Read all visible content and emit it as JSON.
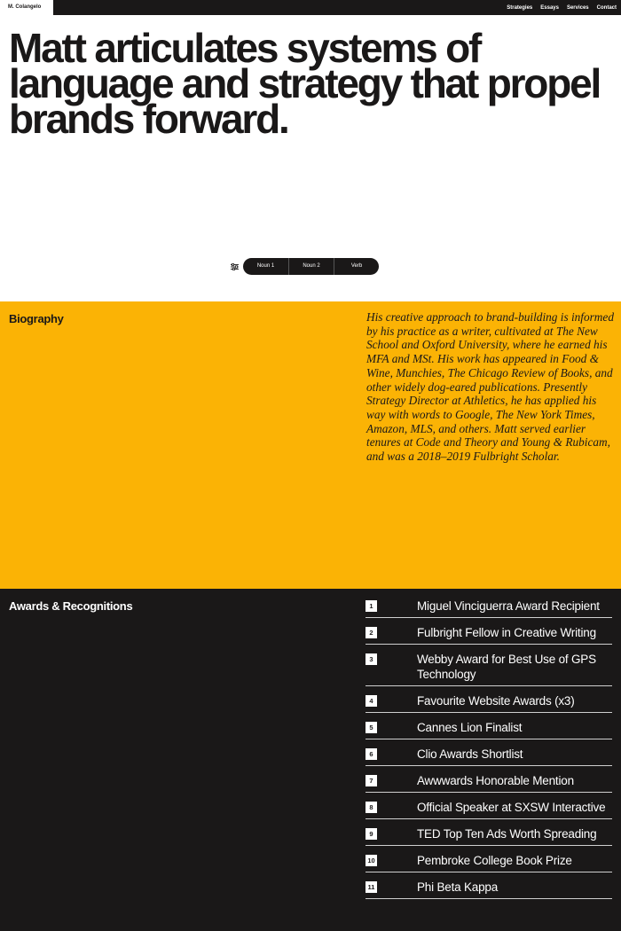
{
  "header": {
    "brand": "M. Colangelo",
    "nav": [
      "Strategies",
      "Essays",
      "Services",
      "Contact"
    ]
  },
  "hero": {
    "title": "Matt articulates systems of language and strategy that propel brands forward."
  },
  "switcher": {
    "icon": "sliders-icon",
    "options": [
      "Noun 1",
      "Noun 2",
      "Verb"
    ]
  },
  "biography": {
    "label": "Biography",
    "text": "His creative approach to brand-building is informed by his practice as a writer, cultivated at The New School and Oxford University, where he earned his MFA and MSt. His work has appeared in Food & Wine, Munchies, The Chicago Review of Books, and other widely dog-eared publications. Presently Strategy Director at Athletics, he has applied his way with words to Google, The New York Times, Amazon, MLS, and others. Matt served earlier tenures at Code and Theory and Young & Rubicam, and was a 2018–2019 Fulbright Scholar."
  },
  "awards": {
    "label": "Awards & Recognitions",
    "items": [
      {
        "num": "1",
        "text": "Miguel Vinciguerra Award Recipient"
      },
      {
        "num": "2",
        "text": "Fulbright Fellow in Creative Writing"
      },
      {
        "num": "3",
        "text": "Webby Award for Best Use of GPS Technology"
      },
      {
        "num": "4",
        "text": "Favourite Website Awards (x3)"
      },
      {
        "num": "5",
        "text": "Cannes Lion Finalist"
      },
      {
        "num": "6",
        "text": "Clio Awards Shortlist"
      },
      {
        "num": "7",
        "text": "Awwwards Honorable Mention"
      },
      {
        "num": "8",
        "text": "Official Speaker at SXSW Interactive"
      },
      {
        "num": "9",
        "text": "TED Top Ten Ads Worth Spreading"
      },
      {
        "num": "10",
        "text": "Pembroke College Book Prize"
      },
      {
        "num": "11",
        "text": "Phi Beta Kappa"
      }
    ]
  },
  "colors": {
    "dark": "#1a1818",
    "accent": "#fbb305",
    "light": "#ffffff"
  }
}
